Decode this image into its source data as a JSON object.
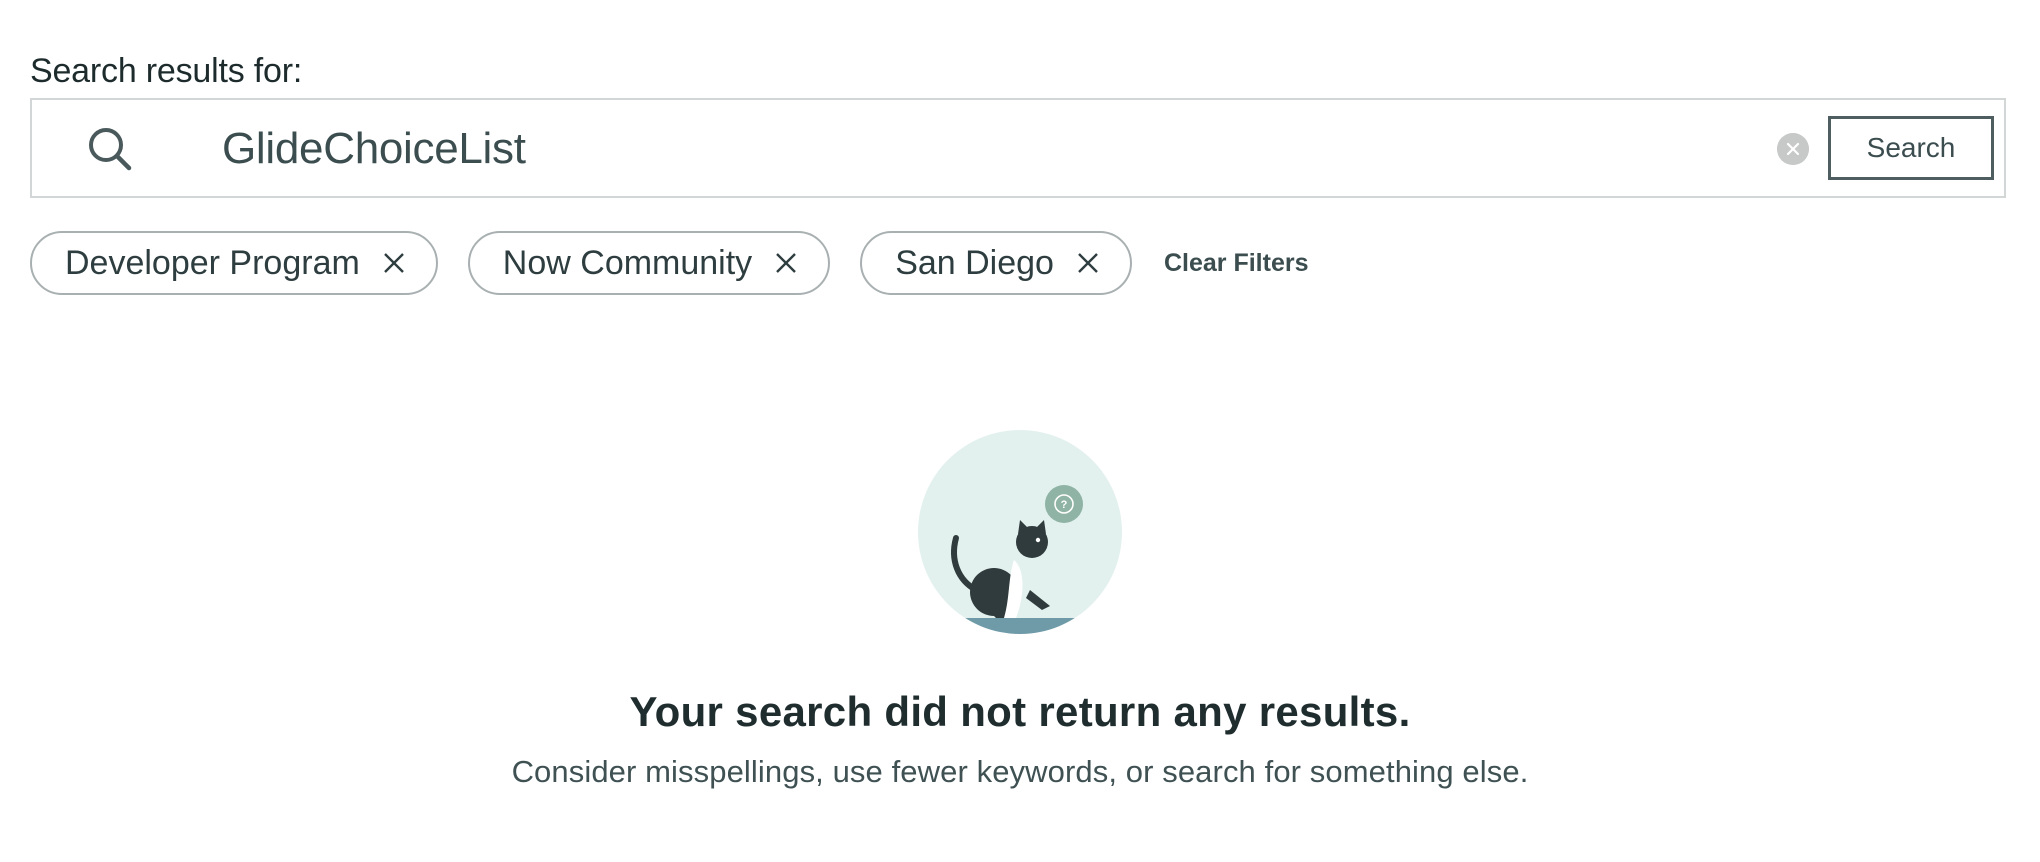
{
  "search": {
    "label": "Search results for:",
    "query": "GlideChoiceList",
    "button_label": "Search",
    "search_icon": "search-icon",
    "clear_icon": "clear-circle-icon"
  },
  "filters": {
    "chips": [
      {
        "label": "Developer Program",
        "remove_icon": "close-icon"
      },
      {
        "label": "Now Community",
        "remove_icon": "close-icon"
      },
      {
        "label": "San Diego",
        "remove_icon": "close-icon"
      }
    ],
    "clear_label": "Clear Filters"
  },
  "empty_state": {
    "illustration": "cat-question-illustration",
    "title": "Your search did not return any results.",
    "message": "Consider misspellings, use fewer keywords, or search for something else."
  },
  "colors": {
    "text_dark": "#1f2d2f",
    "chip_border": "#a9b0b1",
    "illustration_bg": "#e3f1ee",
    "illustration_accent": "#8fb3a4",
    "floor": "#6f9aa8"
  }
}
